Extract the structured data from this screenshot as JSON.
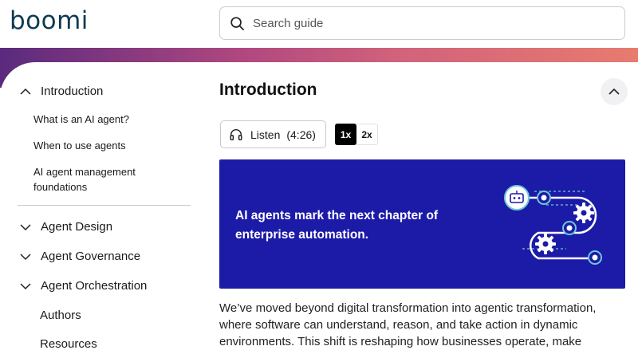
{
  "header": {
    "logo": "boomi",
    "search_placeholder": "Search guide"
  },
  "sidebar": {
    "sections": [
      {
        "label": "Introduction",
        "expanded": true
      },
      {
        "label": "Agent Design",
        "expanded": false
      },
      {
        "label": "Agent Governance",
        "expanded": false
      },
      {
        "label": "Agent Orchestration",
        "expanded": false
      }
    ],
    "intro_items": [
      "What is an AI agent?",
      "When to use agents",
      "AI agent management",
      "foundations"
    ],
    "links": [
      "Authors",
      "Resources"
    ]
  },
  "main": {
    "title": "Introduction",
    "listen_label": "Listen",
    "listen_duration": "(4:26)",
    "speed_options": [
      "1x",
      "2x"
    ],
    "selected_speed": "1x",
    "banner_line1": "AI agents mark the next chapter of",
    "banner_line2": "enterprise automation.",
    "body_line1": "We’ve moved beyond digital transformation into agentic transformation,",
    "body_line2": "where software can understand, reason, and take action in dynamic",
    "body_line3": "environments. This shift is reshaping how businesses operate, make"
  },
  "colors": {
    "brand_dark": "#0e3a52",
    "banner_bg": "#1c1ba8",
    "gradient_start": "#5a2a7e",
    "gradient_end": "#e87b6e"
  },
  "icons": {
    "search": "search-icon",
    "expand": "chevron-down-icon",
    "collapse": "chevron-up-icon",
    "headphones": "headphones-icon"
  }
}
